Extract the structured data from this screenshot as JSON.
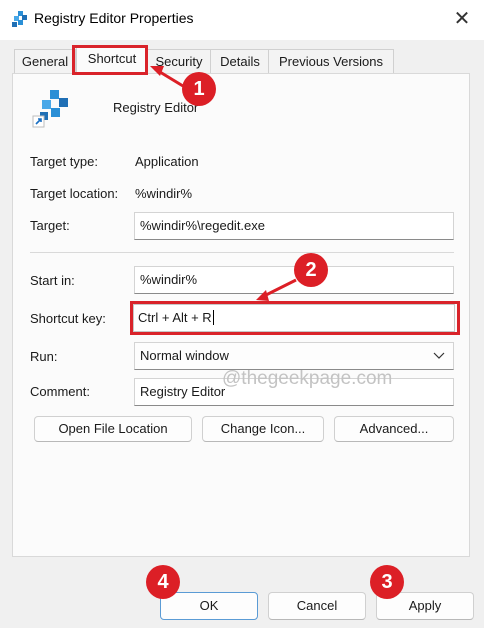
{
  "window": {
    "title": "Registry Editor Properties",
    "close_glyph": "✕"
  },
  "tabs": [
    {
      "label": "General"
    },
    {
      "label": "Shortcut"
    },
    {
      "label": "Security"
    },
    {
      "label": "Details"
    },
    {
      "label": "Previous Versions"
    }
  ],
  "app_name": "Registry Editor",
  "info": {
    "target_type_label": "Target type:",
    "target_type": "Application",
    "target_location_label": "Target location:",
    "target_location": "%windir%",
    "target_label": "Target:",
    "target": "%windir%\\regedit.exe"
  },
  "fields": {
    "start_in_label": "Start in:",
    "start_in": "%windir%",
    "shortcut_key_label": "Shortcut key:",
    "shortcut_key": "Ctrl + Alt + R",
    "run_label": "Run:",
    "run": "Normal window",
    "comment_label": "Comment:",
    "comment": "Registry Editor"
  },
  "actions": {
    "open_file_location": "Open File Location",
    "change_icon": "Change Icon...",
    "advanced": "Advanced..."
  },
  "footer": {
    "ok": "OK",
    "cancel": "Cancel",
    "apply": "Apply"
  },
  "watermark": "@thegeekpage.com",
  "annotations": [
    "1",
    "2",
    "3",
    "4"
  ],
  "colors": {
    "annotation_red": "#dc1f26",
    "accent_blue": "#5a9bd5"
  }
}
